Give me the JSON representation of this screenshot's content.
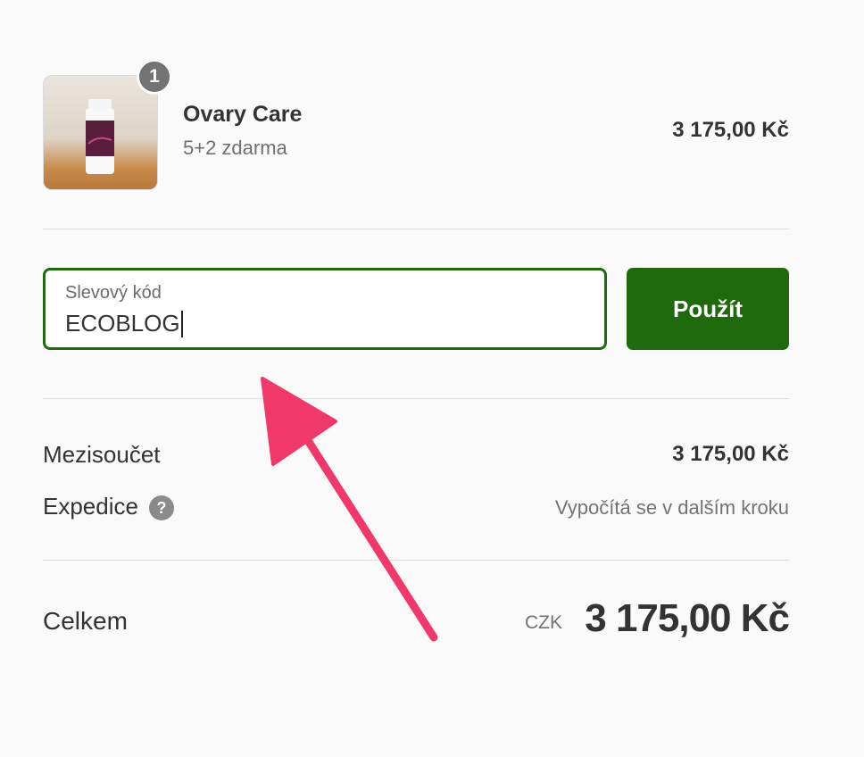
{
  "product": {
    "quantity": "1",
    "name": "Ovary Care",
    "variant": "5+2 zdarma",
    "price": "3 175,00 Kč"
  },
  "discount": {
    "label": "Slevový kód",
    "value": "ECOBLOG",
    "apply_label": "Použít"
  },
  "summary": {
    "subtotal_label": "Mezisoučet",
    "subtotal_value": "3 175,00 Kč",
    "shipping_label": "Expedice",
    "shipping_help_icon": "?",
    "shipping_value": "Vypočítá se v dalším kroku",
    "total_label": "Celkem",
    "total_currency": "CZK",
    "total_value": "3 175,00 Kč"
  },
  "colors": {
    "accent": "#1f6a0d",
    "annotation_arrow": "#f0386b"
  }
}
